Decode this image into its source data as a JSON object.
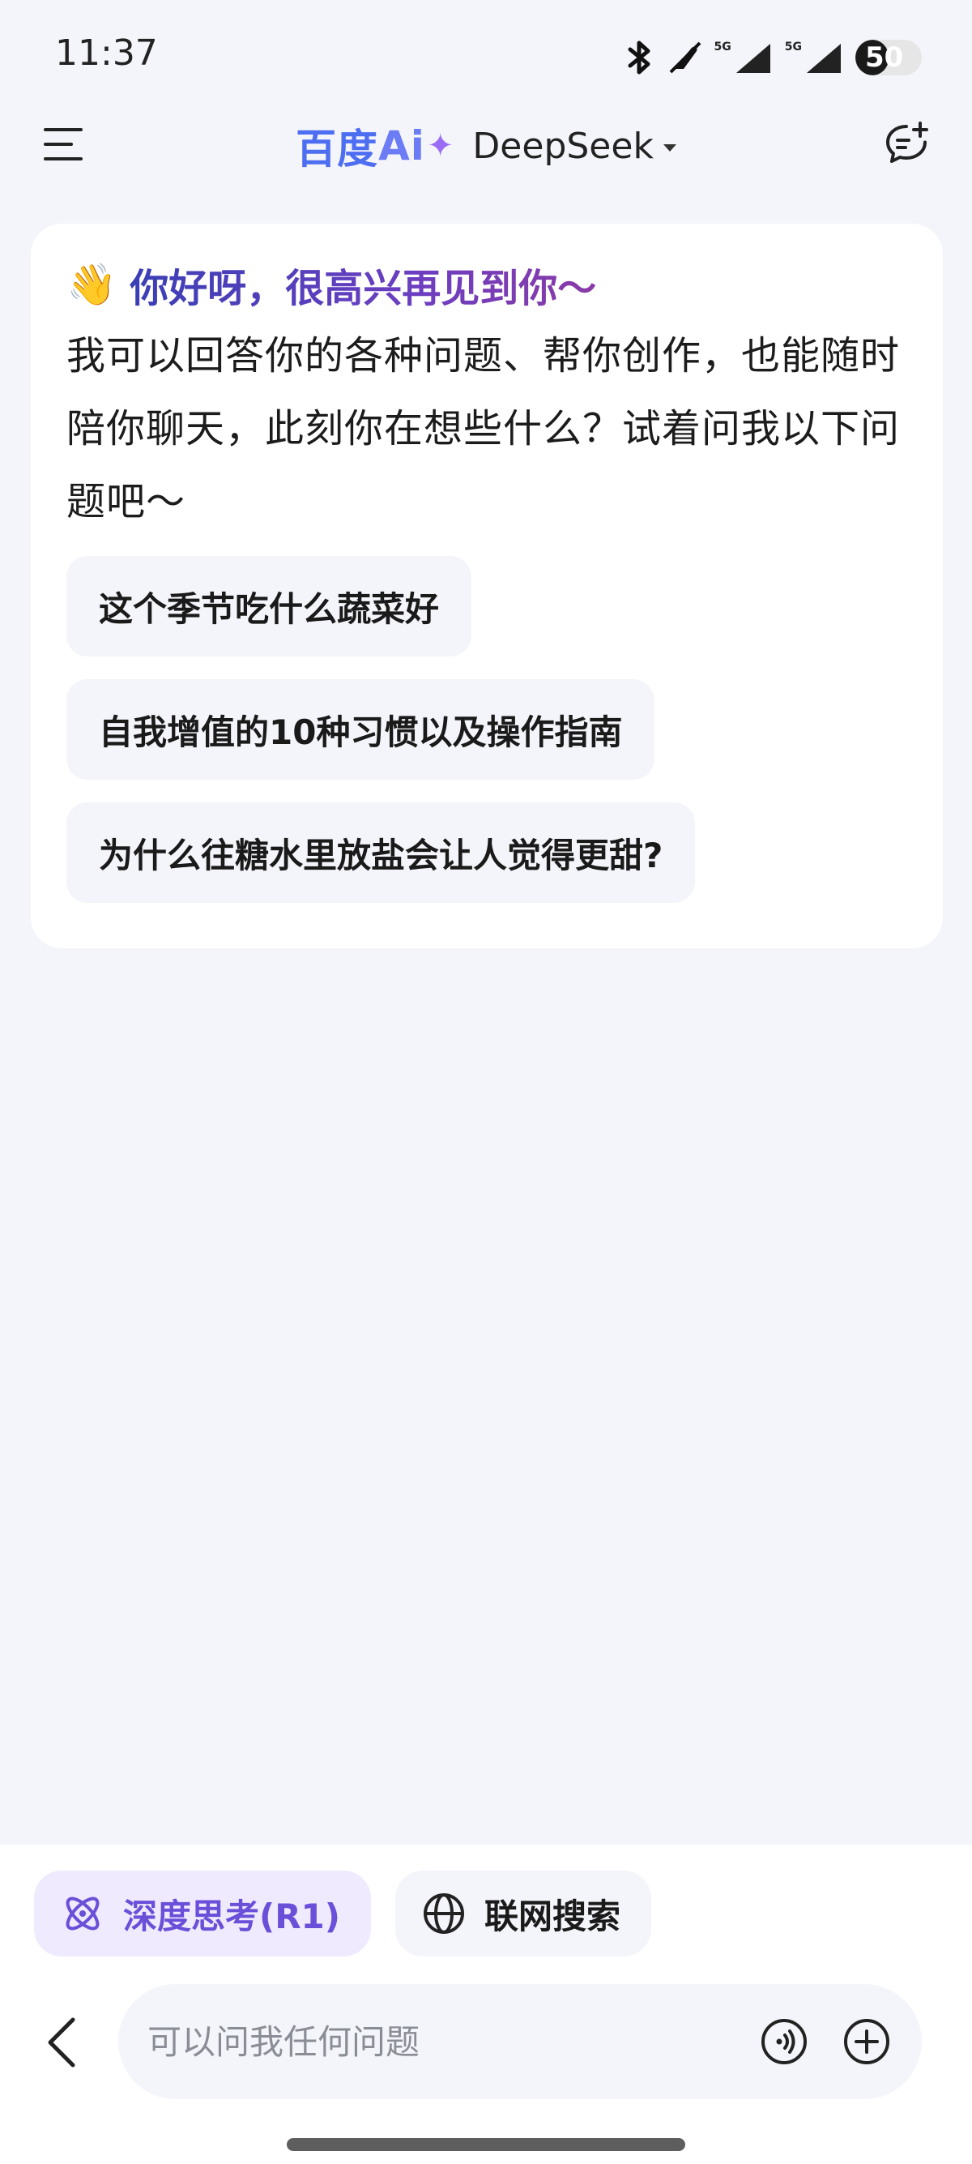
{
  "status_bar": {
    "time": "11:37",
    "network_badge": "5G",
    "battery_level": "50",
    "battery_fraction": 0.5,
    "icons": [
      "bluetooth-icon",
      "mute-icon",
      "signal-icon",
      "signal-icon",
      "battery-icon"
    ]
  },
  "header": {
    "brand_text": "百度",
    "brand_ai": "Ai",
    "brand_spark": "✦",
    "model_name": "DeepSeek",
    "icons": [
      "menu-icon",
      "caret-down-icon",
      "new-chat-icon"
    ]
  },
  "welcome": {
    "emoji": "👋",
    "greeting": "你好呀，很高兴再见到你～",
    "intro": "我可以回答你的各种问题、帮你创作，也能随时陪你聊天，此刻你在想些什么？试着问我以下问题吧～",
    "suggestions": [
      {
        "label": "这个季节吃什么蔬菜好"
      },
      {
        "label": "自我增值的10种习惯以及操作指南"
      },
      {
        "label": "为什么往糖水里放盐会让人觉得更甜?"
      }
    ]
  },
  "composer": {
    "deep_think_label": "深度思考(R1)",
    "web_search_label": "联网搜索",
    "input_value": "",
    "input_placeholder": "可以问我任何问题",
    "icons": [
      "atom-icon",
      "globe-icon",
      "back-icon",
      "voice-icon",
      "plus-icon"
    ]
  },
  "colors": {
    "background": "#f4f5fa",
    "brand_blue": "#4e6ef2",
    "accent_purple": "#6a4fd8",
    "chip_purple_bg": "#efeafe"
  }
}
